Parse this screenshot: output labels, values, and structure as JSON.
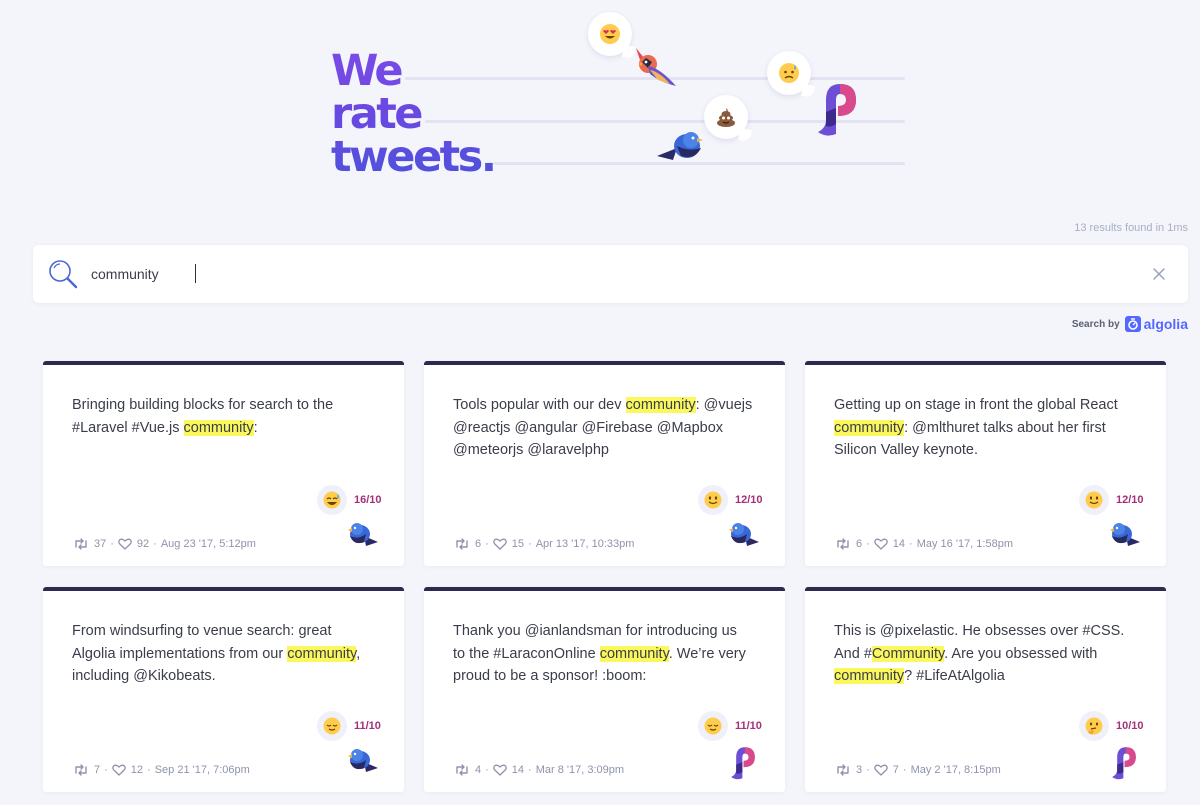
{
  "hero": {
    "title_lines": [
      "We",
      "rate",
      "tweets."
    ]
  },
  "results_text": "13 results found in 1ms",
  "search": {
    "value": "community",
    "placeholder": ""
  },
  "powered_by": {
    "label": "Search by",
    "brand": "algolia"
  },
  "colors": {
    "accent": "#6a48e2",
    "score": "#a3317a",
    "highlight": "#fbf85e",
    "card_top": "#2d2a4f",
    "algolia": "#5468ff"
  },
  "tweets": [
    {
      "text_parts": [
        "Bringing building blocks for search to the #Laravel #Vue.js ",
        "community",
        ":"
      ],
      "emoji": "sweat-smile-face",
      "score": "16/10",
      "retweets": "37",
      "likes": "92",
      "date": "Aug 23 '17, 5:12pm",
      "avatar": "bird-icon"
    },
    {
      "text_parts": [
        "Tools popular with our dev ",
        "community",
        ": @vuejs @reactjs @angular @Firebase @Mapbox @meteorjs @laravelphp"
      ],
      "emoji": "slight-smile-face",
      "score": "12/10",
      "retweets": "6",
      "likes": "15",
      "date": "Apr 13 '17, 10:33pm",
      "avatar": "bird-icon"
    },
    {
      "text_parts": [
        "Getting up on stage in front the global React ",
        "community",
        ": @mlthuret talks about her first Silicon Valley keynote."
      ],
      "emoji": "slight-smile-face",
      "score": "12/10",
      "retweets": "6",
      "likes": "14",
      "date": "May 16 '17, 1:58pm",
      "avatar": "bird-icon"
    },
    {
      "text_parts": [
        "From windsurfing to venue search: great Algolia implementations from our ",
        "community",
        ", including @Kikobeats."
      ],
      "emoji": "relieved-face",
      "score": "11/10",
      "retweets": "7",
      "likes": "12",
      "date": "Sep 21 '17, 7:06pm",
      "avatar": "bird-icon"
    },
    {
      "text_parts": [
        "Thank you @ianlandsman for introducing us to the #LaraconOnline ",
        "community",
        ". We’re very proud to be a sponsor! :boom:"
      ],
      "emoji": "relieved-face",
      "score": "11/10",
      "retweets": "4",
      "likes": "14",
      "date": "Mar 8 '17, 3:09pm",
      "avatar": "pixelastic-logo-icon"
    },
    {
      "text_parts": [
        "This is @pixelastic. He obsesses over #CSS. And #",
        "Community",
        ". Are you obsessed with ",
        "community",
        "? #LifeAtAlgolia"
      ],
      "emoji": "thinking-face",
      "score": "10/10",
      "retweets": "3",
      "likes": "7",
      "date": "May 2 '17, 8:15pm",
      "avatar": "pixelastic-logo-icon"
    }
  ]
}
